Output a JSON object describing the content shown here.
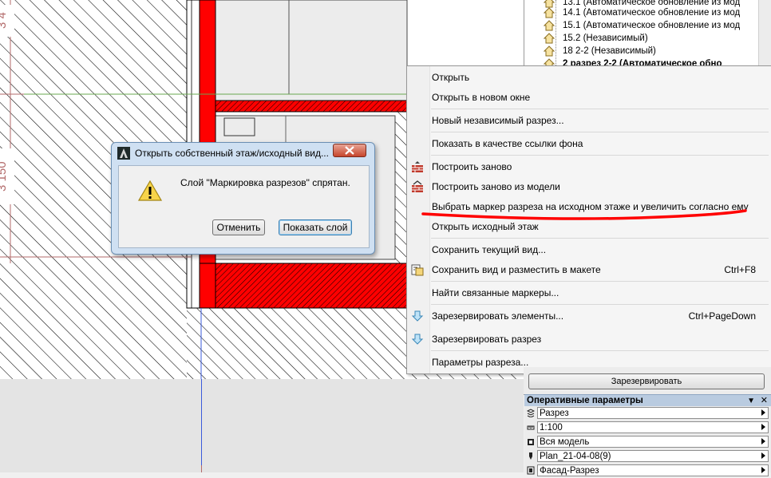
{
  "drawing": {
    "dim_labels": [
      "3 4",
      "3 150"
    ],
    "colors": {
      "wall_fill": "#ff0000",
      "hatch": "#000000",
      "guide_line": "#6aa84f",
      "dim_line": "#b36b6b"
    }
  },
  "navigator": {
    "items": [
      {
        "label": "13.1 (Автоматическое обновление из мод"
      },
      {
        "label": "14.1 (Автоматическое обновление из мод"
      },
      {
        "label": "15.1 (Автоматическое обновление из мод"
      },
      {
        "label": "15.2 (Независимый)"
      },
      {
        "label": "18 2-2 (Независимый)"
      },
      {
        "label": "2 разрез 2-2 (Автоматическое обно"
      }
    ]
  },
  "context_menu": {
    "items": [
      {
        "label": "Открыть",
        "shortcut": "",
        "icon": ""
      },
      {
        "label": "Открыть в новом окне",
        "shortcut": "",
        "icon": ""
      },
      {
        "label": "Новый независимый разрез...",
        "shortcut": "",
        "icon": ""
      },
      {
        "label": "Показать в качестве ссылки фона",
        "shortcut": "",
        "icon": ""
      },
      {
        "label": "Построить заново",
        "shortcut": "",
        "icon": "rebuild-icon"
      },
      {
        "label": "Построить заново из модели",
        "shortcut": "",
        "icon": "rebuild-from-model-icon"
      },
      {
        "label": "Выбрать маркер разреза на исходном этаже и увеличить согласно ему",
        "shortcut": "",
        "icon": ""
      },
      {
        "label": "Открыть исходный этаж",
        "shortcut": "",
        "icon": ""
      },
      {
        "label": "Сохранить текущий вид...",
        "shortcut": "",
        "icon": ""
      },
      {
        "label": "Сохранить вид и разместить в макете",
        "shortcut": "Ctrl+F8",
        "icon": "save-place-layout-icon"
      },
      {
        "label": "Найти связанные маркеры...",
        "shortcut": "",
        "icon": ""
      },
      {
        "label": "Зарезервировать элементы...",
        "shortcut": "Ctrl+PageDown",
        "icon": "reserve-icon"
      },
      {
        "label": "Зарезервировать разрез",
        "shortcut": "",
        "icon": "reserve-icon"
      },
      {
        "label": "Параметры разреза...",
        "shortcut": "",
        "icon": ""
      }
    ]
  },
  "dialog": {
    "title": "Открыть  собственный этаж/исходный вид...",
    "message": "Слой \"Маркировка разрезов\" спрятан.",
    "cancel_label": "Отменить",
    "show_layer_label": "Показать слой"
  },
  "panel": {
    "reserve_label": "Зарезервировать",
    "quick_options_title": "Оперативные параметры",
    "rows": [
      {
        "value": "Разрез",
        "icon": "layer-icon"
      },
      {
        "value": "1:100",
        "icon": "scale-icon"
      },
      {
        "value": "Вся модель",
        "icon": "model-view-icon"
      },
      {
        "value": "Plan_21-04-08(9)",
        "icon": "pen-set-icon"
      },
      {
        "value": "Фасад-Разрез",
        "icon": "dimension-icon"
      }
    ]
  },
  "annotation_color": "#ff0000"
}
